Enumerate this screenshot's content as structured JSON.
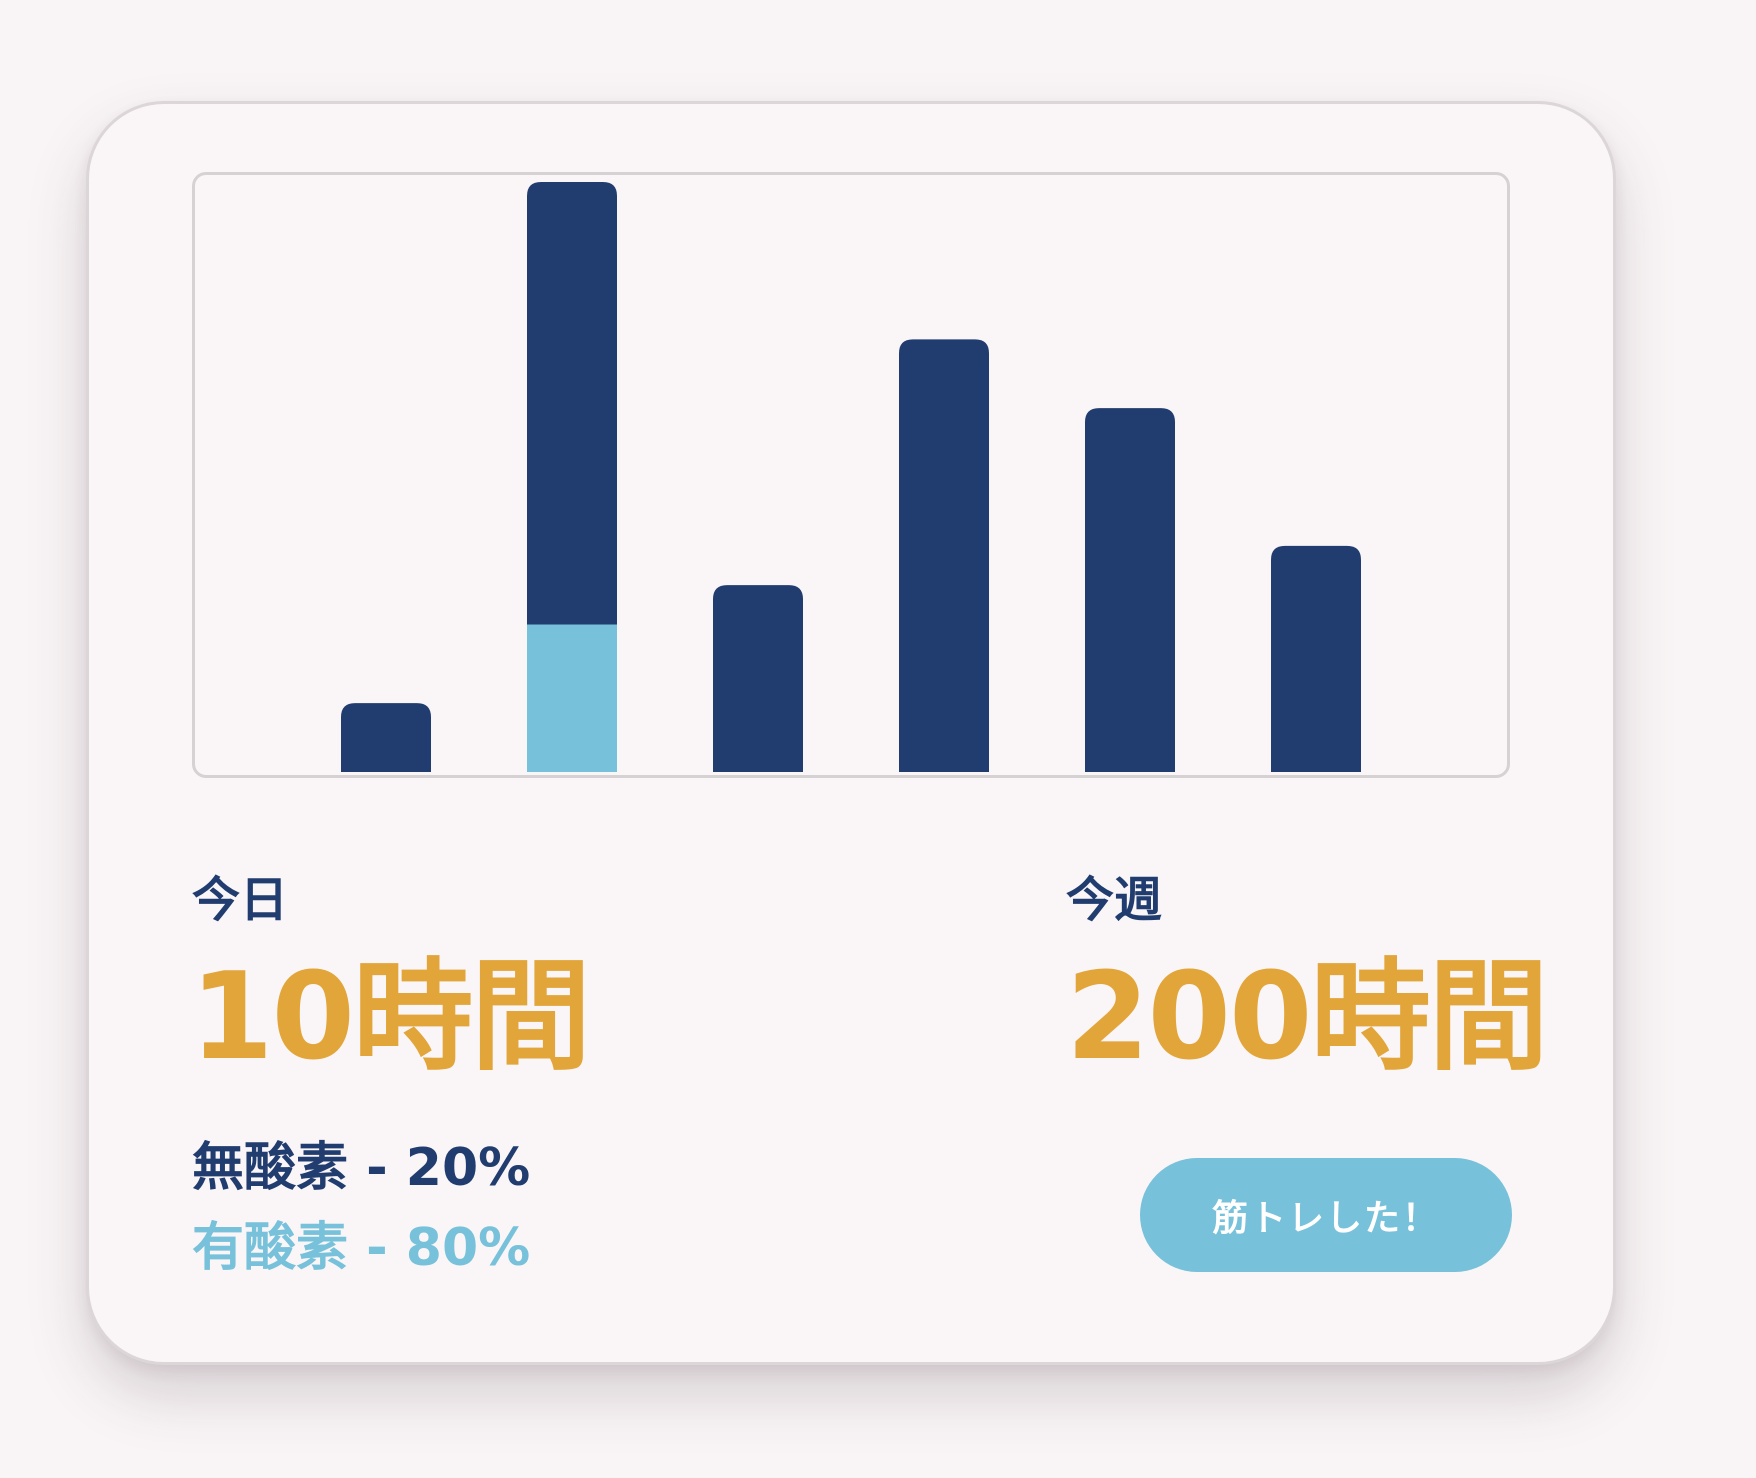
{
  "chart_data": {
    "type": "bar",
    "stacked": true,
    "categories": [
      "",
      "",
      "",
      "",
      "",
      ""
    ],
    "series": [
      {
        "values": [
          0,
          1.5,
          0,
          0,
          0,
          0
        ],
        "color": "#78c1da"
      },
      {
        "values": [
          0.7,
          4.5,
          1.9,
          4.4,
          3.7,
          2.3
        ],
        "color": "#213c6e"
      }
    ],
    "ylim": [
      0,
      6
    ],
    "grid": false,
    "legend": "none"
  },
  "today": {
    "label": "今日",
    "value": "10時間"
  },
  "week": {
    "label": "今週",
    "value": "200時間"
  },
  "ratios": {
    "anaerobic": "無酸素 - 20%",
    "aerobic": "有酸素 - 80%"
  },
  "action_button": {
    "label": "筋トレした！"
  },
  "colors": {
    "navy": "#213c6e",
    "light_blue": "#78c1da",
    "gold": "#e2a53a",
    "background": "#faf6f7"
  }
}
